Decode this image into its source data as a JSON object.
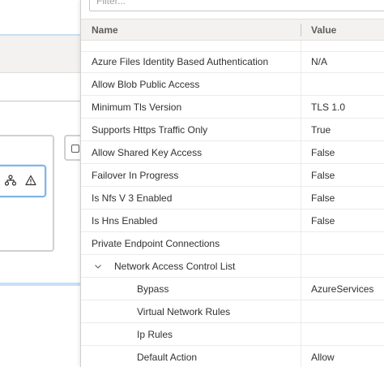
{
  "filter": {
    "placeholder": "Filter..."
  },
  "grid": {
    "headers": {
      "name": "Name",
      "value": "Value"
    },
    "rows": [
      {
        "name": "",
        "value": ""
      },
      {
        "name": "Azure Files Identity Based Authentication",
        "value": "N/A"
      },
      {
        "name": "Allow Blob Public Access",
        "value": ""
      },
      {
        "name": "Minimum Tls Version",
        "value": "TLS 1.0"
      },
      {
        "name": "Supports Https Traffic Only",
        "value": "True"
      },
      {
        "name": "Allow Shared Key Access",
        "value": "False"
      },
      {
        "name": "Failover In Progress",
        "value": "False"
      },
      {
        "name": "Is Nfs V 3 Enabled",
        "value": "False"
      },
      {
        "name": "Is Hns Enabled",
        "value": "False"
      },
      {
        "name": "Private Endpoint Connections",
        "value": ""
      },
      {
        "name": "Network Access Control List",
        "value": ""
      },
      {
        "name": "Bypass",
        "value": "AzureServices"
      },
      {
        "name": "Virtual Network Rules",
        "value": ""
      },
      {
        "name": "Ip Rules",
        "value": ""
      },
      {
        "name": "Default Action",
        "value": "Allow"
      }
    ]
  },
  "canvas": {
    "node_icons": [
      "hierarchy-icon",
      "warning-icon"
    ],
    "tab_icon": "expand-icon"
  },
  "colors": {
    "accent": "#0078d4",
    "node_border": "#80b5e8",
    "header_bg": "#f3f2f1"
  }
}
